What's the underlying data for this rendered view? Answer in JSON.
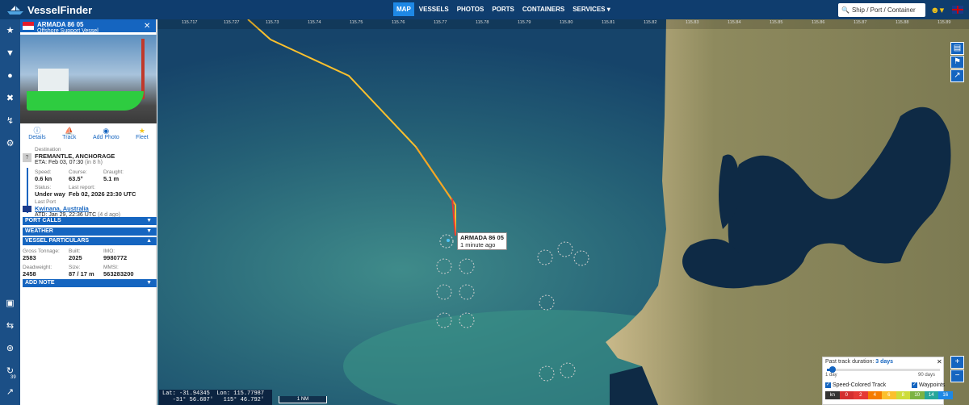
{
  "app": {
    "brand": "VesselFinder"
  },
  "nav": {
    "items": [
      "MAP",
      "VESSELS",
      "PHOTOS",
      "PORTS",
      "CONTAINERS",
      "SERVICES ▾"
    ],
    "active": "MAP"
  },
  "search": {
    "placeholder": "Ship / Port / Container"
  },
  "vessel": {
    "name": "ARMADA 86 05",
    "type": "Offshore Support Vessel",
    "actions": [
      "Details",
      "Track",
      "Add Photo",
      "Fleet"
    ],
    "destination_label": "Destination",
    "destination": "FREMANTLE, ANCHORAGE",
    "eta": "ETA: Feb 03, 07:30",
    "eta_rel": "(in 8 h)",
    "speed_label": "Speed:",
    "speed": "0.6 kn",
    "course_label": "Course:",
    "course": "63.5°",
    "draught_label": "Draught:",
    "draught": "5.1 m",
    "status_label": "Status:",
    "status": "Under way",
    "last_report_label": "Last report:",
    "last_report": "Feb 02, 2026 23:30 UTC",
    "last_port_label": "Last Port",
    "last_port": "Kwinana, Australia",
    "atd": "ATD: Jan 29, 22:36 UTC",
    "atd_rel": "(4 d ago)",
    "unknown_badge": "?"
  },
  "sections": {
    "port_calls": "PORT CALLS",
    "weather": "WEATHER",
    "particulars": "VESSEL PARTICULARS",
    "add_note": "ADD NOTE"
  },
  "particulars": {
    "gt_label": "Gross Tonnage:",
    "gt": "2583",
    "built_label": "Built:",
    "built": "2025",
    "imo_label": "IMO:",
    "imo": "9980772",
    "dwt_label": "Deadweight:",
    "dwt": "2458",
    "size_label": "Size:",
    "size": "87 / 17 m",
    "mmsi_label": "MMSI:",
    "mmsi": "563283200"
  },
  "map": {
    "tooltip_name": "ARMADA 86 05",
    "tooltip_time": "1 minute ago",
    "lat_label": "Lat:",
    "lat": "-31.94345",
    "lat_dms": "-31° 56.607'",
    "lon_label": "Lon:",
    "lon": "115.77987",
    "lon_dms": "115° 46.792'",
    "scale": "1 NM",
    "leftbar_count": "39",
    "lon_ticks": [
      "115.717",
      "115.727",
      "115.73",
      "115.74",
      "115.75",
      "115.76",
      "115.77",
      "115.78",
      "115.79",
      "115.80",
      "115.81",
      "115.82",
      "115.83",
      "115.84",
      "115.85",
      "115.86",
      "115.87",
      "115.88",
      "115.89",
      "115.90"
    ]
  },
  "track_panel": {
    "title": "Past track duration:",
    "duration": "3 days",
    "min": "1 day",
    "max": "90 days",
    "speed_colored": "Speed-Colored Track",
    "waypoints": "Waypoints",
    "legend": [
      "kn",
      "0",
      "2",
      "4",
      "6",
      "8",
      "10",
      "14",
      "16"
    ],
    "legend_colors": [
      "#333333",
      "#d32f2f",
      "#e53935",
      "#f57c00",
      "#fbc02d",
      "#cddc39",
      "#7cb342",
      "#26a69a",
      "#1e88e5"
    ]
  }
}
